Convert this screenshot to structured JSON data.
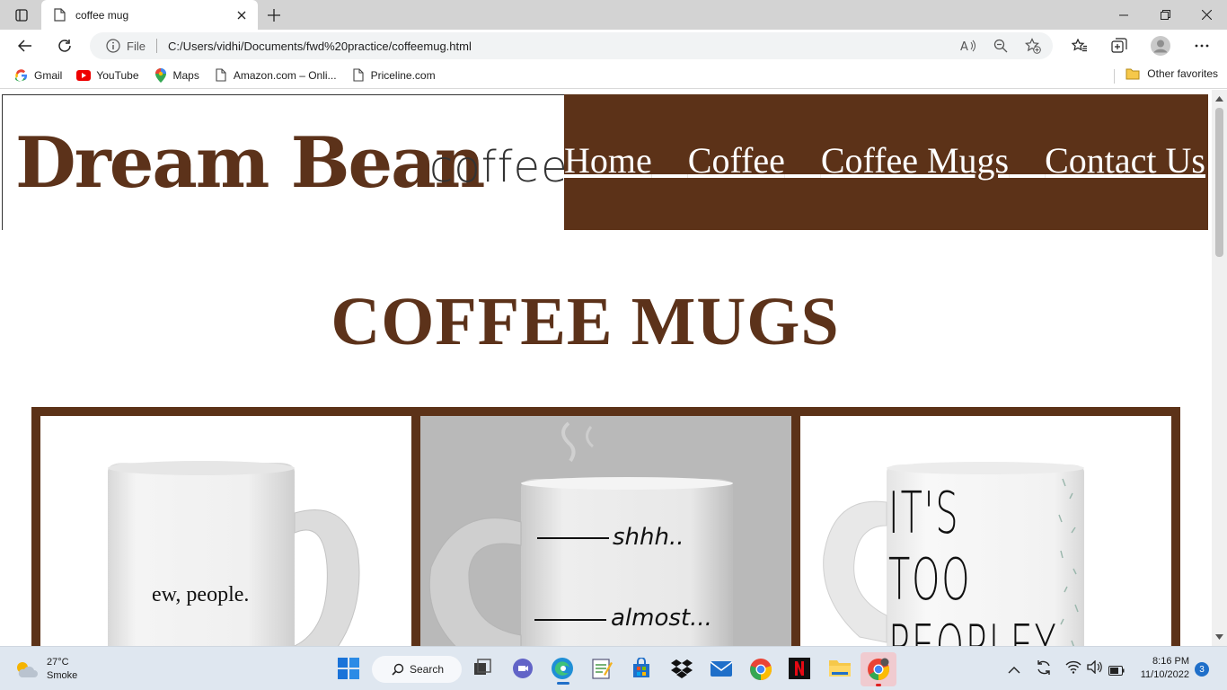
{
  "browser": {
    "tab_title": "coffee mug",
    "address": {
      "scheme_label": "File",
      "url": "C:/Users/vidhi/Documents/fwd%20practice/coffeemug.html"
    },
    "favorites": [
      {
        "label": "Gmail",
        "icon": "gmail-icon"
      },
      {
        "label": "YouTube",
        "icon": "youtube-icon"
      },
      {
        "label": "Maps",
        "icon": "maps-icon"
      },
      {
        "label": "Amazon.com – Onli...",
        "icon": "page-icon"
      },
      {
        "label": "Priceline.com",
        "icon": "page-icon"
      }
    ],
    "other_favorites": "Other favorites"
  },
  "site": {
    "logo_main": "Dream Bean",
    "logo_sub": "coffee",
    "nav": [
      "Home",
      "Coffee",
      "Coffee Mugs",
      "Contact Us"
    ],
    "page_title": "COFFEE MUGS",
    "mugs": [
      {
        "text": "ew, people."
      },
      {
        "text_top": "shhh..",
        "text_bottom": "almost..."
      },
      {
        "text": "IT'S TOO PEOPLEY"
      }
    ]
  },
  "taskbar": {
    "weather_temp": "27°C",
    "weather_desc": "Smoke",
    "search_label": "Search",
    "time": "8:16 PM",
    "date": "11/10/2022",
    "notifications": "3"
  },
  "colors": {
    "brand_brown": "#5c3218",
    "title_brown": "#5c321a"
  }
}
